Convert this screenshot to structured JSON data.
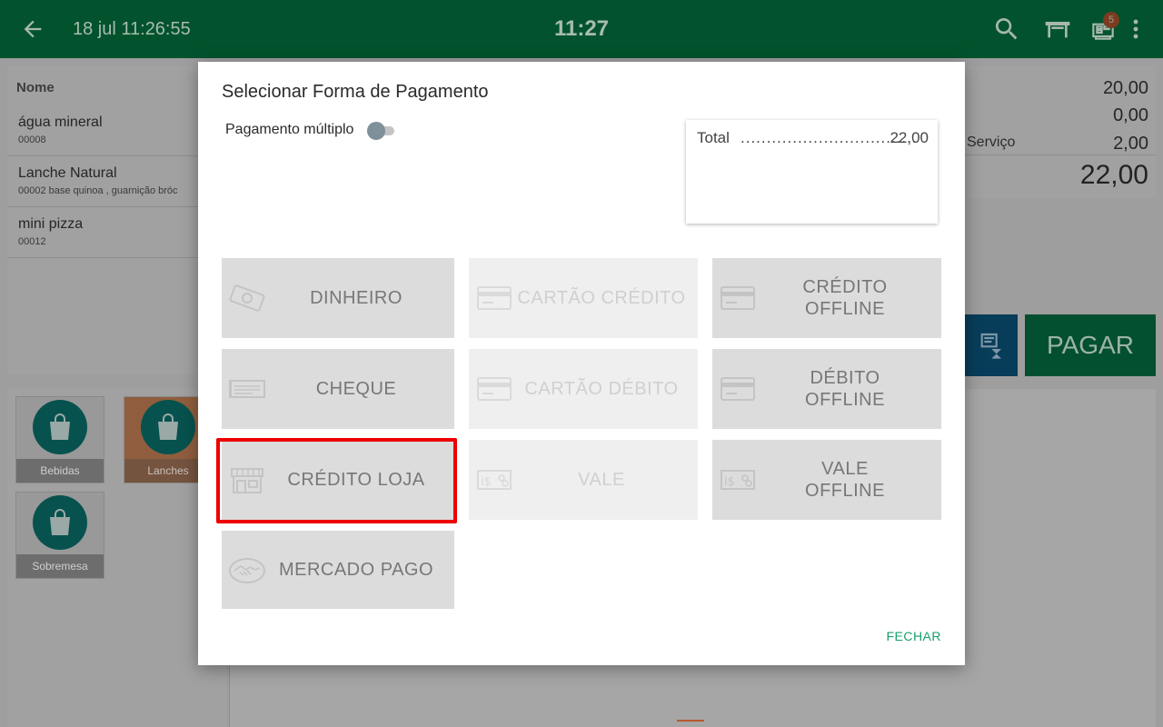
{
  "topbar": {
    "datetime": "18 jul 11:26:55",
    "clock": "11:27",
    "notif_count": "5",
    "icons": [
      "back-arrow-icon",
      "search-icon",
      "table-icon",
      "register-icon",
      "more-vert-icon"
    ]
  },
  "order": {
    "column_title": "Nome",
    "items": [
      {
        "name": "água mineral",
        "code": "00008"
      },
      {
        "name": "Lanche Natural",
        "code": "00002  base quinoa , guarnição bróc"
      },
      {
        "name": "mini pizza",
        "code": "00012"
      }
    ]
  },
  "totals": {
    "line1": "20,00",
    "line2": "0,00",
    "service_label": "Serviço",
    "service_value": "2,00",
    "grand_total": "22,00"
  },
  "pay_button": "PAGAR",
  "categories": [
    {
      "name": "Bebidas",
      "color": "#999999"
    },
    {
      "name": "Lanches",
      "color": "#905e3f"
    },
    {
      "name": "Sobremesa",
      "color": "#999999"
    }
  ],
  "modal": {
    "title": "Selecionar Forma de Pagamento",
    "multiple_label": "Pagamento múltiplo",
    "multiple_enabled": false,
    "total_label": "Total",
    "total_dots": "..................................",
    "total_value": "22,00",
    "methods": [
      {
        "label": "DINHEIRO",
        "icon": "cash-icon",
        "enabled": true
      },
      {
        "label": "CARTÃO CRÉDITO",
        "icon": "credit-card-icon",
        "enabled": false
      },
      {
        "label": "CRÉDITO\nOFFLINE",
        "icon": "credit-card-icon",
        "enabled": true
      },
      {
        "label": "CHEQUE",
        "icon": "cheque-icon",
        "enabled": true
      },
      {
        "label": "CARTÃO DÉBITO",
        "icon": "debit-card-icon",
        "enabled": false
      },
      {
        "label": "DÉBITO\nOFFLINE",
        "icon": "debit-card-icon",
        "enabled": true
      },
      {
        "label": "CRÉDITO LOJA",
        "icon": "store-icon",
        "enabled": true,
        "highlighted": true
      },
      {
        "label": "VALE",
        "icon": "voucher-icon",
        "enabled": false
      },
      {
        "label": "VALE\nOFFLINE",
        "icon": "voucher-icon",
        "enabled": true
      },
      {
        "label": "MERCADO PAGO",
        "icon": "handshake-icon",
        "enabled": true
      }
    ],
    "close_label": "FECHAR"
  },
  "colors": {
    "topbar": "#02532d",
    "accent": "#16a06a",
    "highlight": "#ee0000",
    "tile": "#dcdcdc",
    "tile_disabled": "#efefef"
  }
}
